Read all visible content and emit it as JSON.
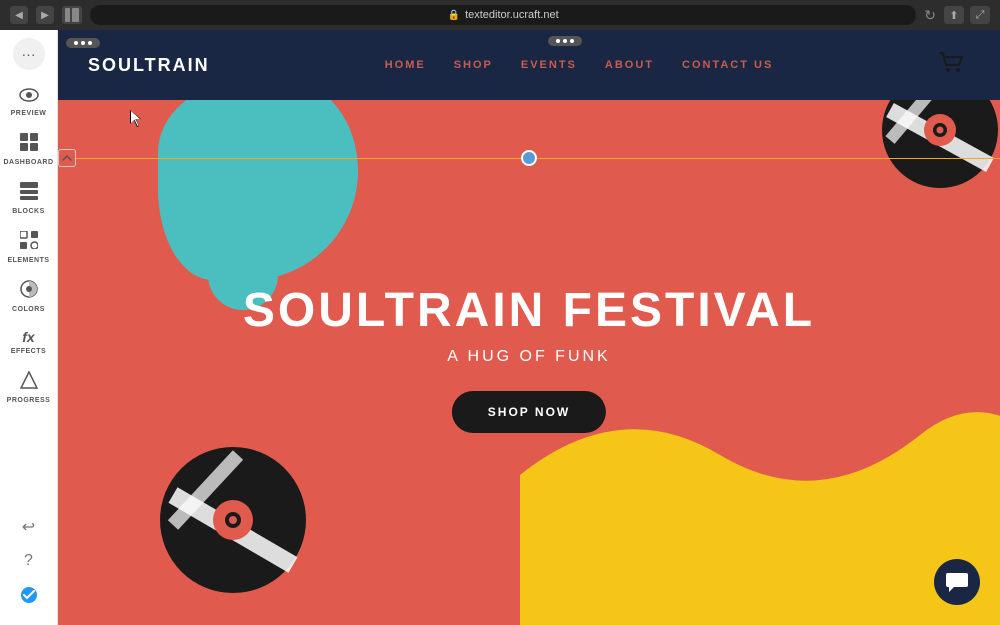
{
  "browser": {
    "url": "texteditor.ucraft.net",
    "back_icon": "◀",
    "forward_icon": "▶",
    "reload_icon": "↻",
    "share_icon": "⬆",
    "maximize_icon": "⤢"
  },
  "sidebar": {
    "more_icon": "···",
    "items": [
      {
        "id": "preview",
        "icon": "👁",
        "label": "PREVIEW"
      },
      {
        "id": "dashboard",
        "icon": "⊞",
        "label": "DASHBOARD"
      },
      {
        "id": "blocks",
        "icon": "▣",
        "label": "BLOCKS"
      },
      {
        "id": "elements",
        "icon": "🧩",
        "label": "ELEMENTS"
      },
      {
        "id": "colors",
        "icon": "◉",
        "label": "COLORS"
      },
      {
        "id": "effects",
        "icon": "fx",
        "label": "EFFECTS"
      },
      {
        "id": "progress",
        "icon": "⬡",
        "label": "PROGRESS"
      }
    ],
    "bottom_items": [
      {
        "id": "undo",
        "icon": "↩"
      },
      {
        "id": "help",
        "icon": "?"
      },
      {
        "id": "check",
        "icon": "✓",
        "color": "blue"
      }
    ]
  },
  "site": {
    "logo": "SOULTRAIN",
    "nav_links": [
      "HOME",
      "SHOP",
      "EVENTS",
      "ABOUT",
      "CONTACT US"
    ],
    "hero_title": "SOULTRAIN FESTIVAL",
    "hero_subtitle": "A HUG OF FUNK",
    "shop_button": "SHOP NOW"
  },
  "colors": {
    "nav_bg": "#1a2744",
    "site_bg": "#e05a4e",
    "teal": "#4BBFBF",
    "yellow": "#F5C518",
    "black": "#1a1a1a",
    "white": "#ffffff"
  }
}
